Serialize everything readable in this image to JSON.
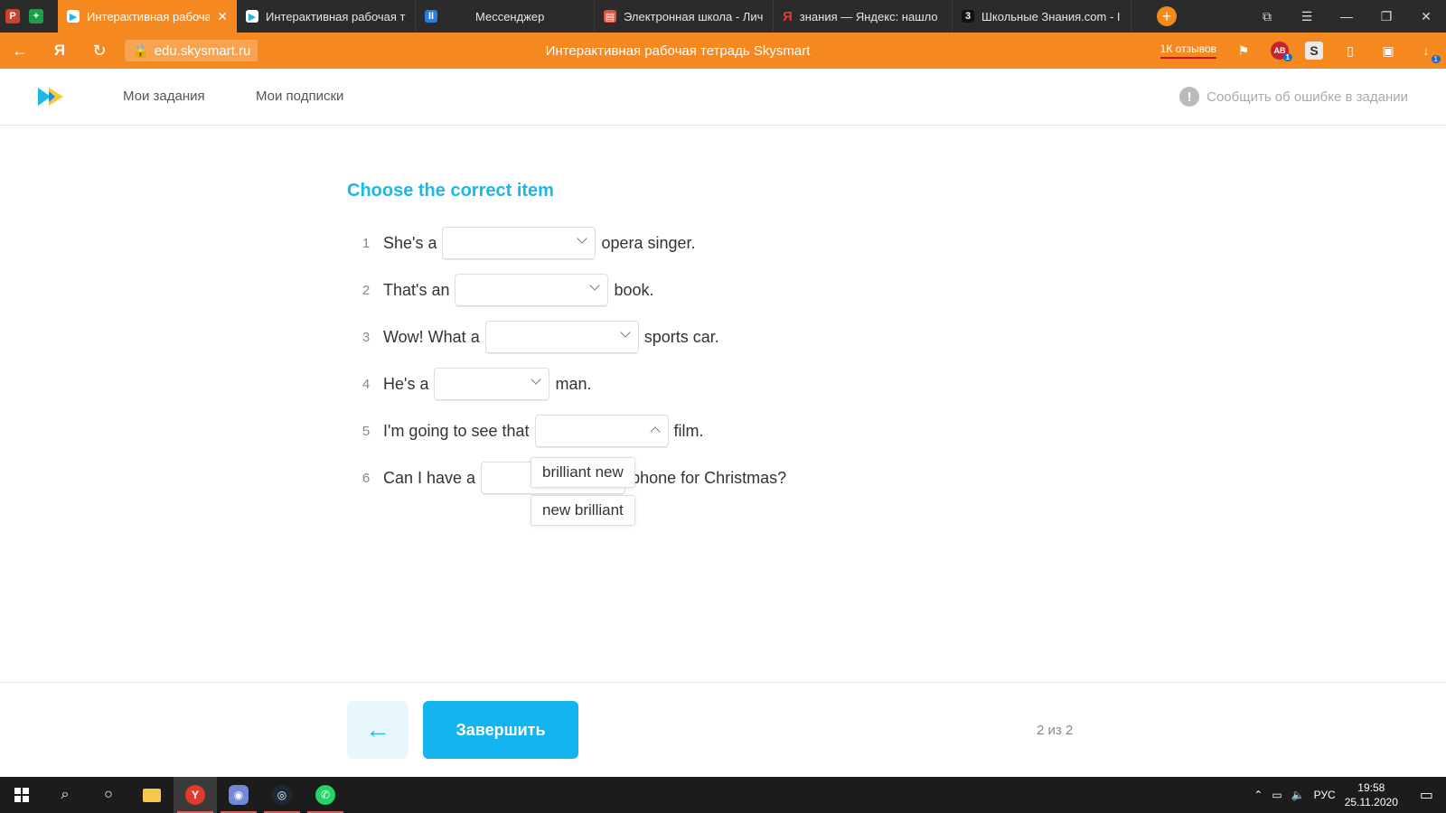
{
  "browser": {
    "tabs": [
      {
        "label": "Интерактивная рабоча",
        "active": true
      },
      {
        "label": "Интерактивная рабочая т",
        "active": false
      },
      {
        "label": "Мессенджер",
        "active": false
      },
      {
        "label": "Электронная школа - Лич",
        "active": false
      },
      {
        "label": "знания — Яндекс: нашло",
        "active": false
      },
      {
        "label": "Школьные Знания.com - I",
        "active": false
      }
    ],
    "url": "edu.skysmart.ru",
    "page_title": "Интерактивная рабочая тетрадь Skysmart",
    "reviews_label": "1К отзывов",
    "accent_color": "#f5891f"
  },
  "site": {
    "nav": [
      "Мои задания",
      "Мои подписки"
    ],
    "report_label": "Сообщить об ошибке в задании"
  },
  "exercise": {
    "title": "Choose the correct item",
    "items": [
      {
        "num": "1",
        "before": "She's a",
        "after": "opera singer."
      },
      {
        "num": "2",
        "before": "That's an",
        "after": "book."
      },
      {
        "num": "3",
        "before": "Wow! What a",
        "after": "sports car."
      },
      {
        "num": "4",
        "before": "He's a",
        "after": "man."
      },
      {
        "num": "5",
        "before": "I'm going to see that",
        "after": "film."
      },
      {
        "num": "6",
        "before": "Can I have a",
        "after": "phone for Christmas?"
      }
    ],
    "open_dropdown_options": [
      "brilliant new",
      "new brilliant"
    ]
  },
  "footer": {
    "finish_label": "Завершить",
    "page_counter": "2 из 2"
  },
  "taskbar": {
    "language": "РУС",
    "time": "19:58",
    "date": "25.11.2020"
  }
}
